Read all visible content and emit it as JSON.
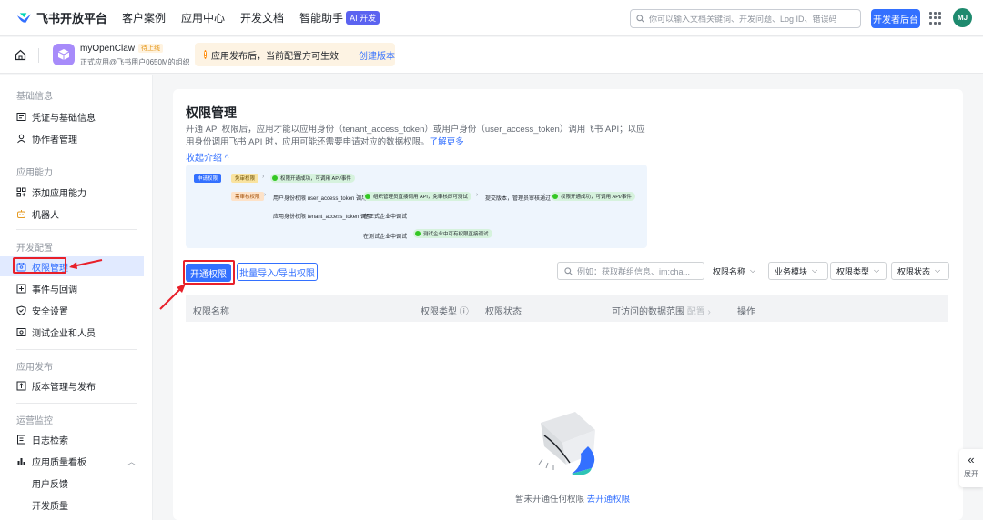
{
  "topnav": {
    "logo_text": "飞书开放平台",
    "links": [
      "客户案例",
      "应用中心",
      "开发文档",
      "智能助手"
    ],
    "ai_badge": "AI 开发",
    "search_placeholder": "你可以输入文档关键词、开发问题、Log ID、错误码",
    "dev_console_label": "开发者后台",
    "avatar_initials": "MJ"
  },
  "appbar": {
    "app_name": "myOpenClaw",
    "app_tag": "待上线",
    "app_sub": "正式应用@飞书用户0650M的组织",
    "notice_text": "应用发布后，当前配置方可生效",
    "notice_link": "创建版本"
  },
  "sidebar": {
    "sections": [
      {
        "title": "基础信息",
        "items": [
          {
            "label": "凭证与基础信息",
            "icon": "credential-icon"
          },
          {
            "label": "协作者管理",
            "icon": "user-icon"
          }
        ]
      },
      {
        "title": "应用能力",
        "items": [
          {
            "label": "添加应用能力",
            "icon": "apps-add-icon"
          },
          {
            "label": "机器人",
            "icon": "robot-icon"
          }
        ]
      },
      {
        "title": "开发配置",
        "items": [
          {
            "label": "权限管理",
            "icon": "permission-icon",
            "active": true
          },
          {
            "label": "事件与回调",
            "icon": "event-icon"
          },
          {
            "label": "安全设置",
            "icon": "shield-icon"
          },
          {
            "label": "测试企业和人员",
            "icon": "test-icon"
          }
        ]
      },
      {
        "title": "应用发布",
        "items": [
          {
            "label": "版本管理与发布",
            "icon": "upload-icon"
          }
        ]
      },
      {
        "title": "运营监控",
        "items": [
          {
            "label": "日志检索",
            "icon": "log-icon"
          },
          {
            "label": "应用质量看板",
            "icon": "chart-icon"
          },
          {
            "label": "用户反馈",
            "icon": ""
          },
          {
            "label": "开发质量",
            "icon": ""
          }
        ]
      }
    ]
  },
  "main": {
    "title": "权限管理",
    "description": "开通 API 权限后，应用才能以应用身份（tenant_access_token）或用户身份（user_access_token）调用飞书 API；以应用身份调用飞书 API 时，应用可能还需要申请对应的数据权限。",
    "learn_more": "了解更多",
    "collapse_label": "收起介绍 ^",
    "diagram": {
      "step_apply": "申请权限",
      "free_perm": "免审权限",
      "free_perm_result": "权限开通成功，可调用 API/事件",
      "review_perm": "需审核权限",
      "user_identity": "用户身份权限 user_access_token 调用",
      "user_identity_note": "组织管理员直接调用 API，免审核即可测试",
      "submit_version": "提交版本，管理员审核通过",
      "review_result": "权限开通成功，可调用 API/事件",
      "app_identity": "应用身份权限 tenant_access_token 调用",
      "official_tenant": "在正式企业中调试",
      "test_tenant": "在测试企业中调试",
      "test_tenant_note": "测试企业中可有权限直接调试"
    },
    "primary_button": "开通权限",
    "batch_button": "批量导入/导出权限",
    "filter_search_placeholder": "例如：获取群组信息、im:cha...",
    "filters": [
      "权限名称",
      "业务模块",
      "权限类型",
      "权限状态"
    ],
    "columns": [
      "权限名称",
      "权限类型",
      "权限状态",
      "可访问的数据范围",
      "配置",
      "操作"
    ],
    "empty_text": "暂未开通任何权限",
    "empty_link": "去开通权限"
  },
  "side_expand_label": "展开",
  "colors": {
    "accent": "#3370ff",
    "annotation_red": "#e8202a"
  }
}
